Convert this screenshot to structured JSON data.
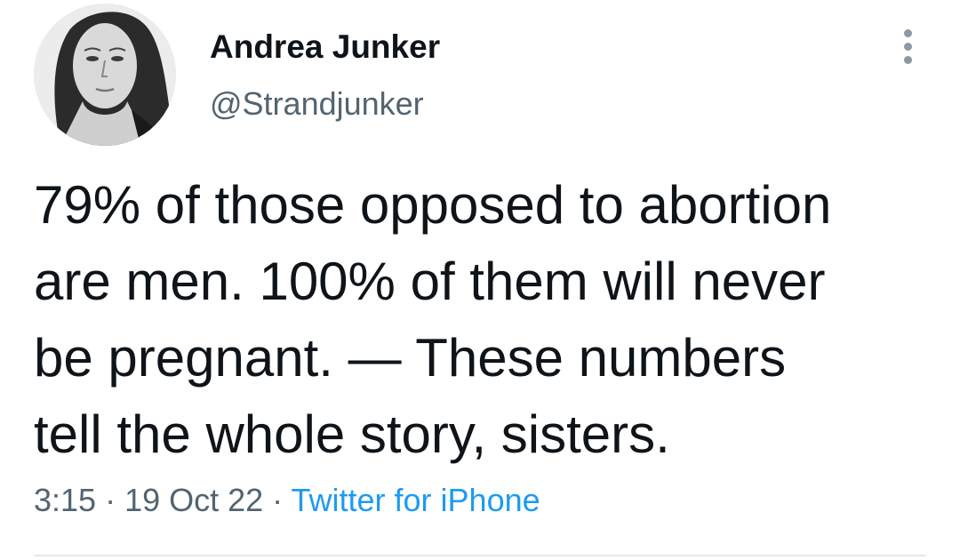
{
  "author": {
    "name": "Andrea Junker",
    "handle": "@Strandjunker"
  },
  "tweet": {
    "line1": "79% of those opposed to abortion",
    "line2": "are men. 100% of them will never",
    "line3": "be pregnant. — These numbers",
    "line4": "tell the whole story, sisters."
  },
  "meta": {
    "time": "3:15",
    "separator1": " · ",
    "date": "19 Oct 22",
    "separator2": " · ",
    "source": "Twitter for iPhone"
  },
  "icons": {
    "more": "more-vertical-icon"
  },
  "colors": {
    "text": "#0f1419",
    "secondary": "#536471",
    "link": "#1d9bf0"
  }
}
